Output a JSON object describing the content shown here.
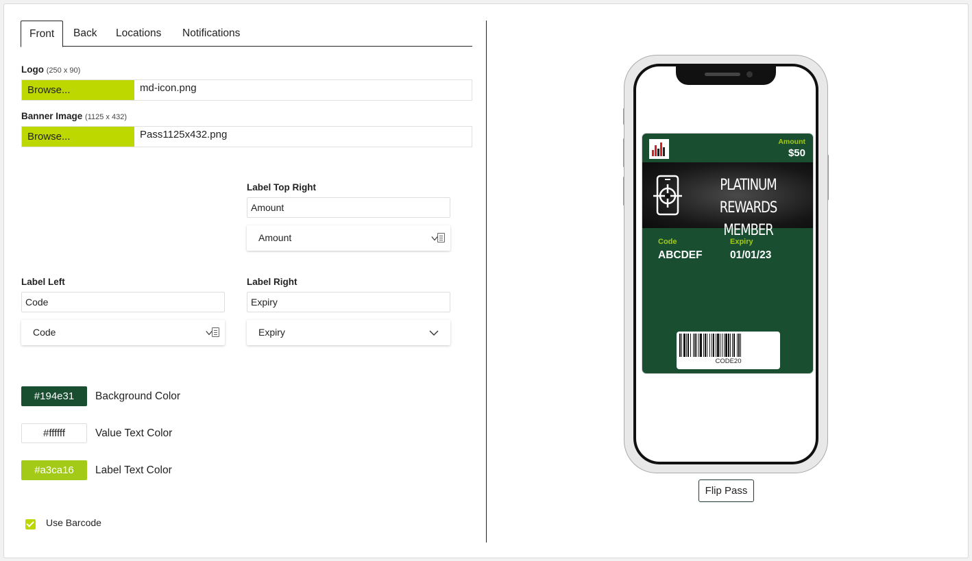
{
  "tabs": [
    {
      "label": "Front",
      "active": true
    },
    {
      "label": "Back",
      "active": false
    },
    {
      "label": "Locations",
      "active": false
    },
    {
      "label": "Notifications",
      "active": false
    }
  ],
  "logo": {
    "label": "Logo",
    "dims": "(250 x 90)",
    "browse": "Browse...",
    "file": "md-icon.png"
  },
  "banner": {
    "label": "Banner Image",
    "dims": "(1125 x 432)",
    "browse": "Browse...",
    "file": "Pass1125x432.png"
  },
  "fields": {
    "top_right": {
      "label": "Label Top Right",
      "value": "Amount",
      "select": "Amount"
    },
    "left": {
      "label": "Label Left",
      "value": "Code",
      "select": "Code"
    },
    "right": {
      "label": "Label Right",
      "value": "Expiry",
      "select": "Expiry"
    }
  },
  "colors": {
    "background": {
      "value": "#194e31",
      "label": "Background Color"
    },
    "value_text": {
      "value": "#ffffff",
      "label": "Value Text Color"
    },
    "label_text": {
      "value": "#a3ca16",
      "label": "Label Text Color"
    }
  },
  "use_barcode": {
    "label": "Use Barcode",
    "checked": true
  },
  "pass": {
    "amount_label": "Amount",
    "amount_value": "$50",
    "banner_title_1": "PLATINUM REWARDS",
    "banner_title_2": "MEMBER",
    "code_label": "Code",
    "code_value": "ABCDEF",
    "expiry_label": "Expiry",
    "expiry_value": "01/01/23",
    "barcode_text": "CODE20"
  },
  "flip_button": "Flip Pass"
}
